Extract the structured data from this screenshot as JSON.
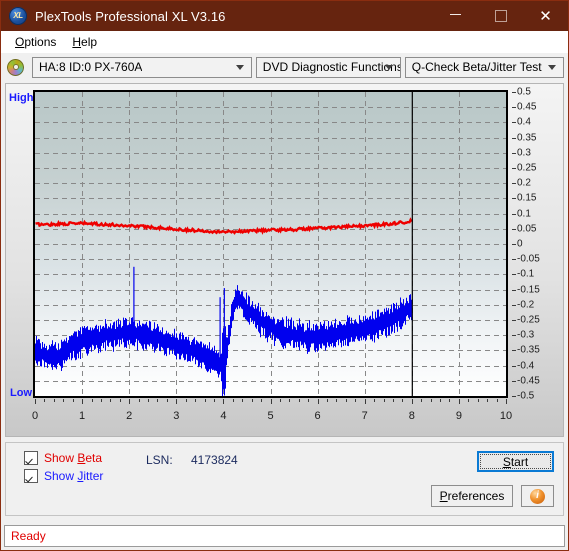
{
  "window": {
    "title": "PlexTools Professional XL V3.16",
    "app_icon": "xl-disc-icon",
    "minimize_label": "Minimize",
    "maximize_label": "Maximize",
    "close_label": "✕"
  },
  "menubar": {
    "items": [
      {
        "label": "Options",
        "accel": "O"
      },
      {
        "label": "Help",
        "accel": "H"
      }
    ]
  },
  "toolbar": {
    "drive_icon": "optical-disc-icon",
    "drive_combo": {
      "value": "HA:8 ID:0  PX-760A"
    },
    "function_combo": {
      "value": "DVD Diagnostic Functions"
    },
    "test_combo": {
      "value": "Q-Check Beta/Jitter Test"
    }
  },
  "chart_data": {
    "type": "line",
    "title": "Q-Check Beta/Jitter Test",
    "xlabel": "",
    "ylabel": "",
    "xlim": [
      0,
      10
    ],
    "ylim": [
      -0.5,
      0.5
    ],
    "grid": true,
    "legend_position": "bottom-left",
    "x_ticks": [
      "0",
      "1",
      "2",
      "3",
      "4",
      "5",
      "6",
      "7",
      "8",
      "9",
      "10"
    ],
    "y_ticks_right": [
      "0.5",
      "0.45",
      "0.4",
      "0.35",
      "0.3",
      "0.25",
      "0.2",
      "0.15",
      "0.1",
      "0.05",
      "0",
      "-0.05",
      "-0.1",
      "-0.15",
      "-0.2",
      "-0.25",
      "-0.3",
      "-0.35",
      "-0.4",
      "-0.45",
      "-0.5"
    ],
    "y_axis_left_labels": {
      "high": "High",
      "low": "Low"
    },
    "data_end_x": 8,
    "layer_break_x": 4,
    "series": [
      {
        "name": "Beta",
        "color": "#ee0000",
        "axis": "right",
        "description": "Beta value trace, slowly varying near 0.06",
        "x": [
          0.0,
          0.25,
          0.5,
          0.75,
          1.0,
          1.25,
          1.5,
          1.75,
          2.0,
          2.25,
          2.5,
          2.75,
          3.0,
          3.25,
          3.5,
          3.75,
          4.0,
          4.25,
          4.5,
          4.75,
          5.0,
          5.25,
          5.5,
          5.75,
          6.0,
          6.25,
          6.5,
          6.75,
          7.0,
          7.25,
          7.5,
          7.75,
          8.0
        ],
        "values": [
          0.065,
          0.064,
          0.066,
          0.067,
          0.068,
          0.066,
          0.064,
          0.062,
          0.06,
          0.058,
          0.055,
          0.052,
          0.048,
          0.046,
          0.044,
          0.042,
          0.04,
          0.041,
          0.043,
          0.044,
          0.046,
          0.047,
          0.048,
          0.05,
          0.052,
          0.054,
          0.056,
          0.058,
          0.06,
          0.063,
          0.066,
          0.07,
          0.076
        ]
      },
      {
        "name": "Jitter",
        "color": "#0000ee",
        "axis": "right",
        "description": "Jitter band trace; noisy envelope with layer break spike at x=4",
        "x": [
          0.0,
          0.25,
          0.5,
          0.75,
          1.0,
          1.25,
          1.5,
          1.75,
          2.0,
          2.25,
          2.5,
          2.75,
          3.0,
          3.25,
          3.5,
          3.75,
          4.0,
          4.25,
          4.5,
          4.75,
          5.0,
          5.25,
          5.5,
          5.75,
          6.0,
          6.25,
          6.5,
          6.75,
          7.0,
          7.25,
          7.5,
          7.75,
          8.0
        ],
        "values": [
          -0.355,
          -0.37,
          -0.368,
          -0.34,
          -0.32,
          -0.31,
          -0.3,
          -0.295,
          -0.29,
          -0.295,
          -0.305,
          -0.318,
          -0.33,
          -0.345,
          -0.362,
          -0.38,
          -0.4,
          -0.17,
          -0.215,
          -0.25,
          -0.275,
          -0.29,
          -0.3,
          -0.305,
          -0.308,
          -0.3,
          -0.292,
          -0.285,
          -0.278,
          -0.268,
          -0.252,
          -0.23,
          -0.205
        ],
        "spikes": [
          {
            "x": 2.1,
            "value": -0.075
          },
          {
            "x": 3.93,
            "value": -0.175
          },
          {
            "x": 4.02,
            "value": -0.145
          }
        ]
      }
    ]
  },
  "controls": {
    "show_beta": {
      "label_prefix": "Show ",
      "label_accel": "B",
      "label_suffix": "eta",
      "checked": true
    },
    "show_jitter": {
      "label_prefix": "Show ",
      "label_accel": "J",
      "label_suffix": "itter",
      "checked": true
    },
    "lsn": {
      "label": "LSN:",
      "value": "4173824"
    },
    "start_button": {
      "prefix": "",
      "accel": "S",
      "suffix": "tart",
      "focused": true
    },
    "preferences_button": {
      "prefix": "",
      "accel": "P",
      "suffix": "references"
    },
    "info_button": {
      "glyph": "i"
    }
  },
  "statusbar": {
    "text": "Ready",
    "color": "#e00000"
  }
}
